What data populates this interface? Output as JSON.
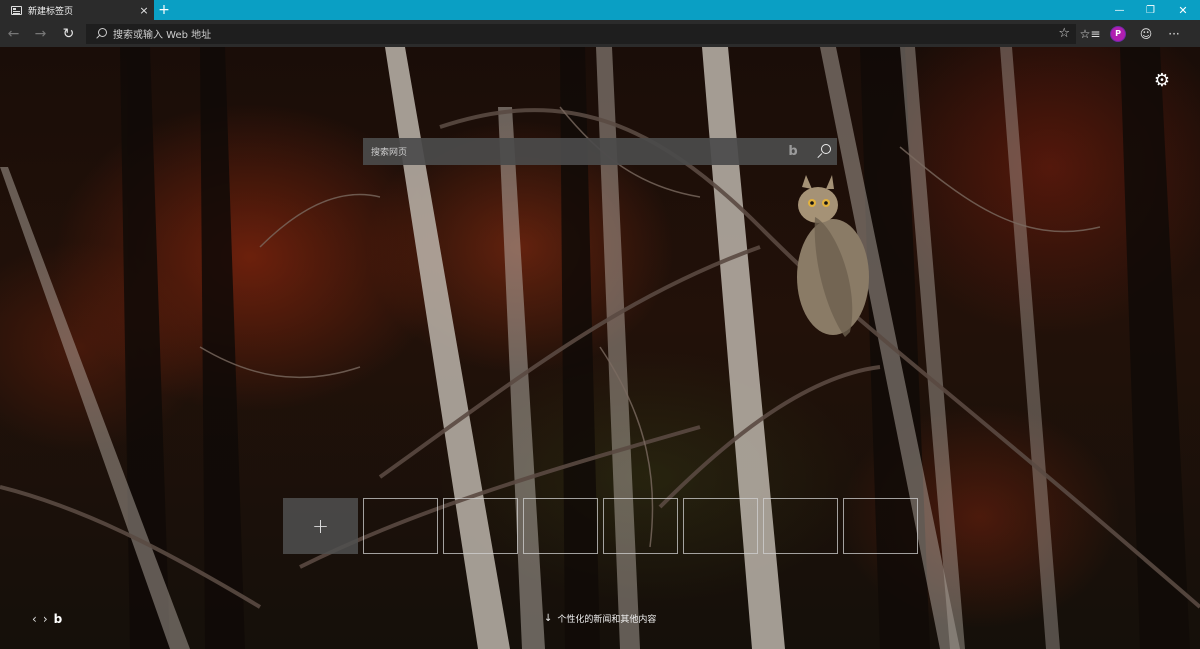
{
  "tab": {
    "title": "新建标签页",
    "close": "×",
    "new": "+"
  },
  "window": {
    "minimize": "—",
    "restore": "❐",
    "close": "✕"
  },
  "addressbar": {
    "back": "←",
    "forward": "→",
    "refresh": "↻",
    "placeholder": "搜索或输入 Web 地址",
    "favorite": "☆",
    "favorites_bar": "☆≡",
    "profile": "P",
    "feedback": "☺",
    "more": "···"
  },
  "newtab": {
    "settings": "⚙",
    "search_placeholder": "搜索网页",
    "bing_mark": "b",
    "add_tile": "+",
    "prev": "‹",
    "next": "›",
    "bing_logo": "b",
    "news_arrow": "↓",
    "news_label": "个性化的新闻和其他内容"
  },
  "colors": {
    "titlebar": "#0a9fc4",
    "toolbar": "#2b2b2b",
    "profile": "#b01fb0"
  }
}
